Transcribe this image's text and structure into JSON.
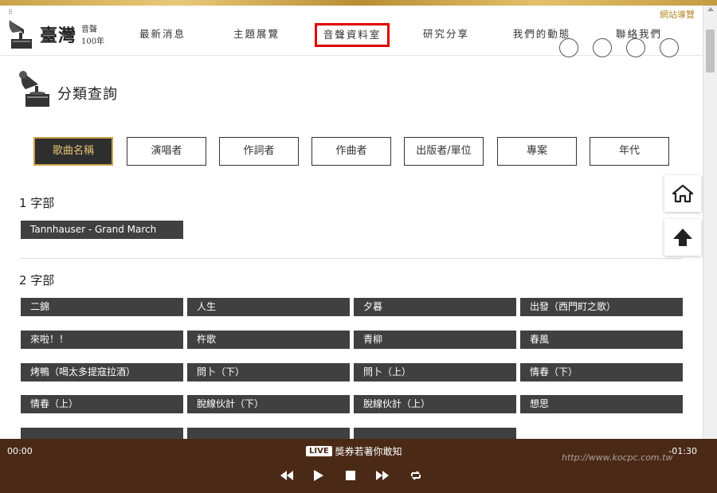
{
  "header": {
    "logo_main": "臺灣",
    "logo_sub1": "音聲",
    "logo_sub2": "100年",
    "sitemap": "網站導覽",
    "nav": [
      "最新消息",
      "主題展覽",
      "音聲資料室",
      "研究分享",
      "我們的動態",
      "聯絡我們"
    ],
    "active_nav": "音聲資料室"
  },
  "page": {
    "title": "分類查詢",
    "tabs": [
      "歌曲名稱",
      "演唱者",
      "作詞者",
      "作曲者",
      "出版者/單位",
      "專案",
      "年代"
    ],
    "active_tab": "歌曲名稱"
  },
  "sections": [
    {
      "heading": "1 字部",
      "items": [
        "Tannhauser - Grand March"
      ]
    },
    {
      "heading": "2 字部",
      "items": [
        "二錦",
        "人生",
        "夕暮",
        "出發（西門町之歌）",
        "來啦！！",
        "杵歌",
        "青柳",
        "春風",
        "烤鴨（喝太多提寇拉酒）",
        "問卜（下）",
        "問卜（上）",
        "情春（下）",
        "情春（上）",
        "脫線伙計（下）",
        "脫線伙計（上）",
        "想思"
      ]
    }
  ],
  "player": {
    "time_elapsed": "00:00",
    "time_remaining": "-01:30",
    "live_badge": "LIVE",
    "track_title": "獎券若著你敢知"
  },
  "watermark": "http://www.kocpc.com.tw"
}
